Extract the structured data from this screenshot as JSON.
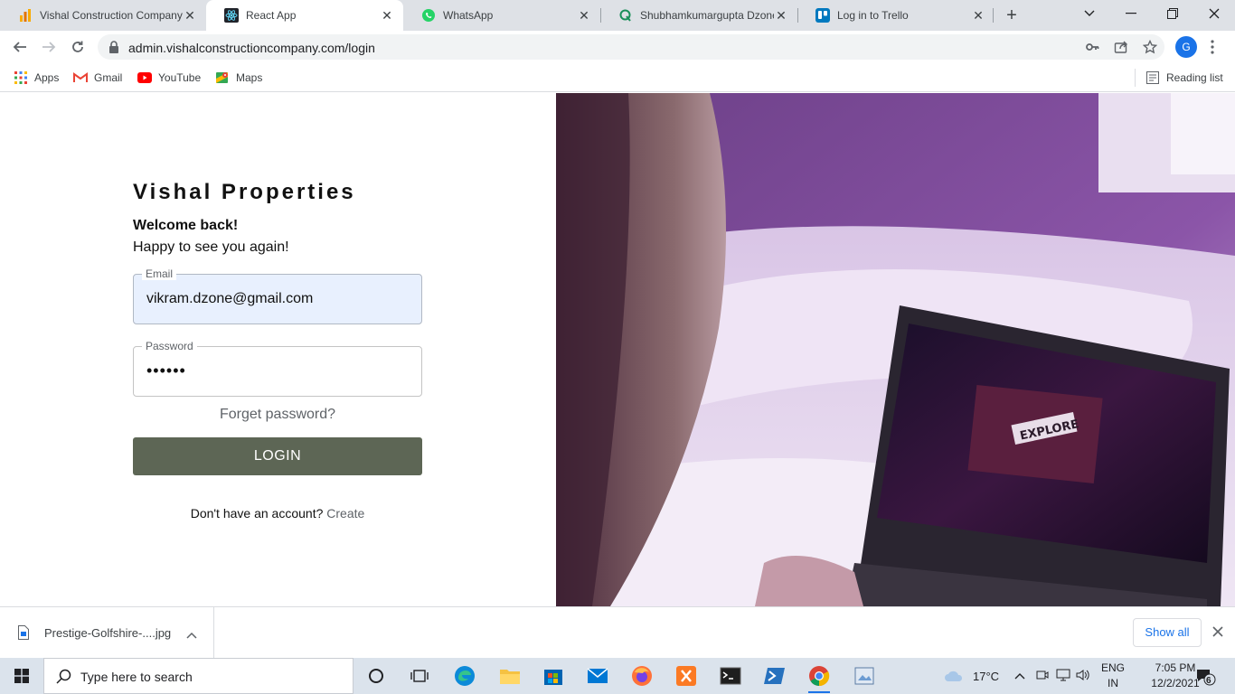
{
  "browser": {
    "tabs": [
      {
        "title": "Vishal Construction Company",
        "favicon": "chart-icon",
        "active": false
      },
      {
        "title": "React App",
        "favicon": "react-icon",
        "active": true
      },
      {
        "title": "WhatsApp",
        "favicon": "whatsapp-icon",
        "active": false
      },
      {
        "title": "Shubhamkumargupta Dzone",
        "favicon": "q-icon",
        "active": false
      },
      {
        "title": "Log in to Trello",
        "favicon": "trello-icon",
        "active": false
      }
    ],
    "url": "admin.vishalconstructioncompany.com/login",
    "profile_initial": "G",
    "bookmarks": [
      {
        "label": "Apps",
        "icon": "apps-grid-icon"
      },
      {
        "label": "Gmail",
        "icon": "gmail-icon"
      },
      {
        "label": "YouTube",
        "icon": "youtube-icon"
      },
      {
        "label": "Maps",
        "icon": "maps-icon"
      }
    ],
    "reading_list": "Reading list"
  },
  "login": {
    "brand": "Vishal Properties",
    "welcome": "Welcome back!",
    "subtitle": "Happy to see you again!",
    "email_label": "Email",
    "email_value": "vikram.dzone@gmail.com",
    "password_label": "Password",
    "password_value": "••••••",
    "forget": "Forget password?",
    "login_button": "LOGIN",
    "no_account": "Don't have an account?",
    "create": "Create"
  },
  "hero": {
    "laptop_screen_text": "EXPLORE"
  },
  "downloads": {
    "file_name": "Prestige-Golfshire-....jpg",
    "show_all": "Show all"
  },
  "taskbar": {
    "search_placeholder": "Type here to search",
    "temperature": "17°C",
    "lang_line1": "ENG",
    "lang_line2": "IN",
    "time": "7:05 PM",
    "date": "12/2/2021",
    "notification_count": "6"
  },
  "colors": {
    "login_button": "#5d6655",
    "email_fill": "#e8f0fe",
    "accent": "#1a73e8"
  }
}
